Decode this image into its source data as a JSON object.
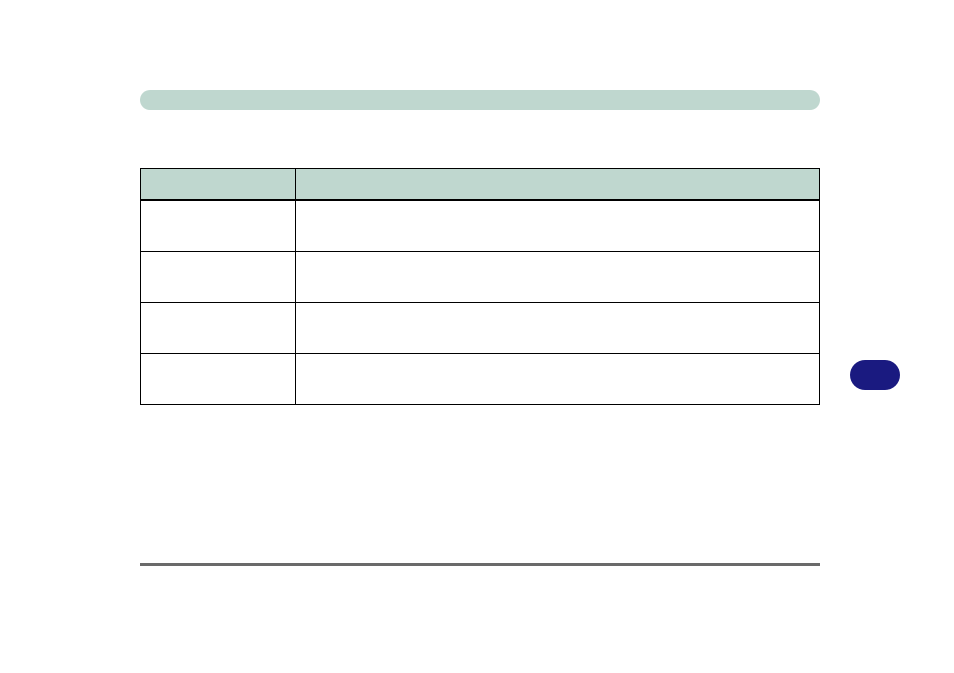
{
  "header": {
    "title": ""
  },
  "table": {
    "columns": [
      {
        "label": ""
      },
      {
        "label": ""
      }
    ],
    "rows": [
      {
        "c1": "",
        "c2": ""
      },
      {
        "c1": "",
        "c2": ""
      },
      {
        "c1": "",
        "c2": ""
      },
      {
        "c1": "",
        "c2": ""
      }
    ]
  },
  "button": {
    "label": ""
  },
  "footer": {
    "text": ""
  }
}
